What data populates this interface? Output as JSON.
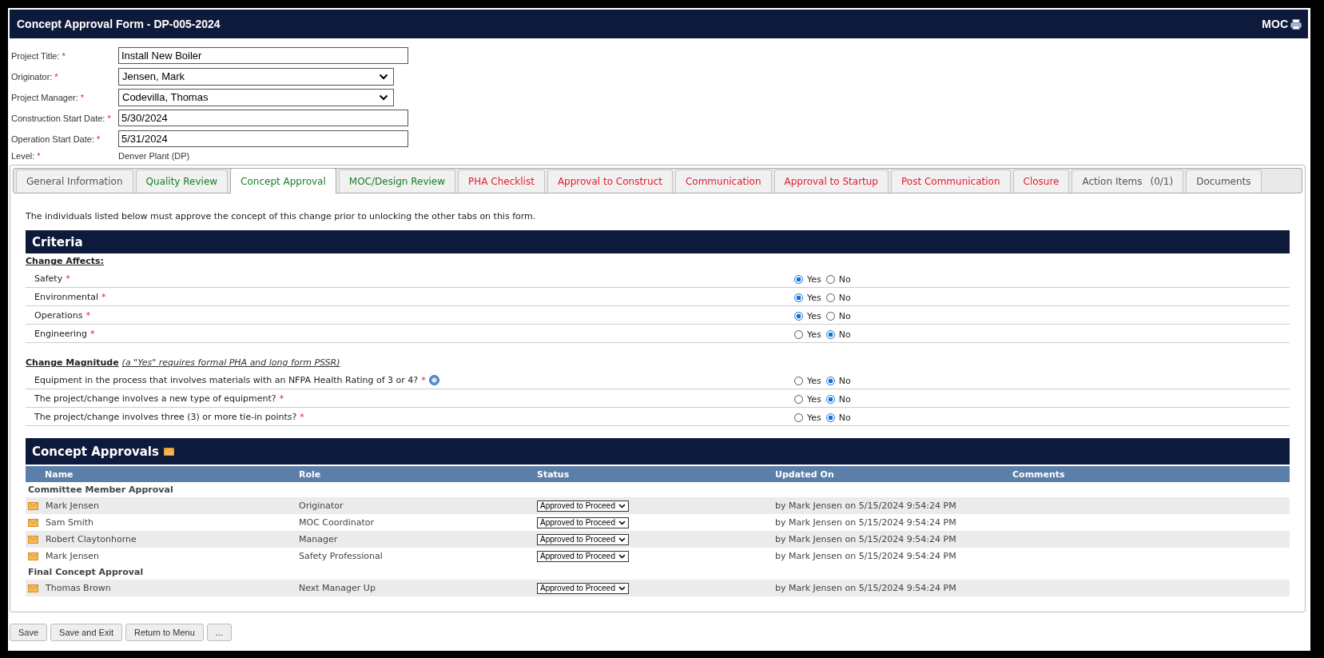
{
  "header": {
    "title": "Concept Approval Form - DP-005-2024",
    "module": "MOC"
  },
  "fields": [
    {
      "label": "Project Title:",
      "required_mark": "*",
      "kind": "text",
      "value": "Install New Boiler"
    },
    {
      "label": "Originator:",
      "required_mark": "*",
      "kind": "select",
      "value": "Jensen, Mark"
    },
    {
      "label": "Project Manager:",
      "required_mark": "*",
      "kind": "select",
      "value": "Codevilla, Thomas"
    },
    {
      "label": "Construction Start Date:",
      "required_mark": "*",
      "kind": "text",
      "value": "5/30/2024"
    },
    {
      "label": "Operation Start Date:",
      "required_mark": "*",
      "kind": "text",
      "value": "5/31/2024"
    },
    {
      "label": "Level:",
      "required_mark": "*",
      "kind": "static",
      "value": "Denver Plant (DP)"
    }
  ],
  "tabs": [
    {
      "label": "General Information",
      "color": "#555555",
      "selected": false
    },
    {
      "label": "Quality Review",
      "color": "#1a7d23",
      "selected": false
    },
    {
      "label": "Concept Approval",
      "color": "#1a7d23",
      "selected": true
    },
    {
      "label": "MOC/Design Review",
      "color": "#1a7d23",
      "selected": false
    },
    {
      "label": "PHA Checklist",
      "color": "#e41b2b",
      "selected": false
    },
    {
      "label": "Approval to Construct",
      "color": "#e41b2b",
      "selected": false
    },
    {
      "label": "Communication",
      "color": "#e41b2b",
      "selected": false
    },
    {
      "label": "Approval to Startup",
      "color": "#e41b2b",
      "selected": false
    },
    {
      "label": "Post Communication",
      "color": "#e41b2b",
      "selected": false
    },
    {
      "label": "Closure",
      "color": "#e41b2b",
      "selected": false
    },
    {
      "label": "Action Items",
      "count": "(0/1)",
      "color": "#555555",
      "selected": false
    },
    {
      "label": "Documents",
      "color": "#555555",
      "selected": false
    }
  ],
  "intro": "The individuals listed below must approve the concept of this change prior to unlocking the other tabs on this form.",
  "criteria": {
    "title": "Criteria",
    "groups": [
      {
        "heading": "Change Affects:",
        "rows": [
          {
            "question": "Safety",
            "required_mark": "*",
            "options": [
              {
                "label": "Yes",
                "selected": true
              },
              {
                "label": "No",
                "selected": false
              }
            ]
          },
          {
            "question": "Environmental",
            "required_mark": "*",
            "options": [
              {
                "label": "Yes",
                "selected": true
              },
              {
                "label": "No",
                "selected": false
              }
            ]
          },
          {
            "question": "Operations",
            "required_mark": "*",
            "options": [
              {
                "label": "Yes",
                "selected": true
              },
              {
                "label": "No",
                "selected": false
              }
            ]
          },
          {
            "question": "Engineering",
            "required_mark": "*",
            "options": [
              {
                "label": "Yes",
                "selected": false
              },
              {
                "label": "No",
                "selected": true
              }
            ]
          }
        ]
      },
      {
        "heading": "Change Magnitude",
        "note": "(a \"Yes\" requires formal PHA and long form PSSR)",
        "rows": [
          {
            "question": "Equipment in the process that involves materials with an NFPA Health Rating of 3 or 4?",
            "required_mark": "*",
            "help": true,
            "options": [
              {
                "label": "Yes",
                "selected": false
              },
              {
                "label": "No",
                "selected": true
              }
            ]
          },
          {
            "question": "The project/change involves a new type of equipment?",
            "required_mark": "*",
            "options": [
              {
                "label": "Yes",
                "selected": false
              },
              {
                "label": "No",
                "selected": true
              }
            ]
          },
          {
            "question": "The project/change involves three (3) or more tie-in points?",
            "required_mark": "*",
            "options": [
              {
                "label": "Yes",
                "selected": false
              },
              {
                "label": "No",
                "selected": true
              }
            ]
          }
        ]
      }
    ]
  },
  "approvals": {
    "title": "Concept Approvals",
    "columns": [
      "Name",
      "Role",
      "Status",
      "Updated On",
      "Comments"
    ],
    "groups": [
      {
        "title": "Committee Member Approval",
        "rows": [
          {
            "name": "Mark Jensen",
            "role": "Originator",
            "status": "Approved to Proceed",
            "updated": "by Mark Jensen on 5/15/2024 9:54:24 PM"
          },
          {
            "name": "Sam Smith",
            "role": "MOC Coordinator",
            "status": "Approved to Proceed",
            "updated": "by Mark Jensen on 5/15/2024 9:54:24 PM"
          },
          {
            "name": "Robert Claytonhorne",
            "role": "Manager",
            "status": "Approved to Proceed",
            "updated": "by Mark Jensen on 5/15/2024 9:54:24 PM"
          },
          {
            "name": "Mark Jensen",
            "role": "Safety Professional",
            "status": "Approved to Proceed",
            "updated": "by Mark Jensen on 5/15/2024 9:54:24 PM"
          }
        ]
      },
      {
        "title": "Final Concept Approval",
        "rows": [
          {
            "name": "Thomas Brown",
            "role": "Next Manager Up",
            "status": "Approved to Proceed",
            "updated": "by Mark Jensen on 5/15/2024 9:54:24 PM"
          }
        ]
      }
    ]
  },
  "buttons": [
    "Save",
    "Save and Exit",
    "Return to Menu",
    "..."
  ]
}
